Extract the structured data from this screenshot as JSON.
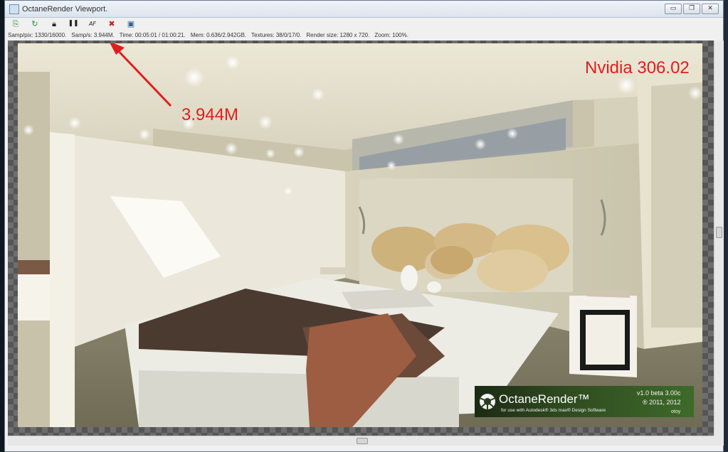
{
  "window": {
    "title": "OctaneRender Viewport.",
    "controls": {
      "minimize": "▭",
      "restore": "❐",
      "close": "✕"
    }
  },
  "toolbar": {
    "items": [
      {
        "name": "send-scene-icon",
        "glyph": "⎘",
        "color": "green"
      },
      {
        "name": "restart-icon",
        "glyph": "↻",
        "color": "green"
      },
      {
        "name": "lock-icon",
        "glyph": "🔒︎",
        "color": ""
      },
      {
        "name": "pause-icon",
        "glyph": "❚❚",
        "color": ""
      },
      {
        "name": "af-focus-icon",
        "glyph": "AF",
        "color": ""
      },
      {
        "name": "stop-icon",
        "glyph": "✖",
        "color": "red"
      },
      {
        "name": "settings-screen-icon",
        "glyph": "▣",
        "color": "blue"
      }
    ]
  },
  "status": {
    "samples_per_pixel": "Samp/pix: 1330/16000.",
    "samples_per_second": "Samp/s: 3.944M.",
    "time": "Time: 00:05:01 / 01:00:21.",
    "mem": "Mem: 0.636/2.942GB.",
    "textures": "Textures: 38/0/17/0.",
    "render_size": "Render size: 1280 x 720.",
    "zoom": "Zoom: 100%."
  },
  "annotations": {
    "speed_callout": "3.944M",
    "gpu_driver": "Nvidia 306.02"
  },
  "logo": {
    "name": "OctaneRender™",
    "tagline": "for use with Autodesk® 3ds max® Design Software",
    "version": "v1.0 beta 3.00c",
    "copyright": "® 2011, 2012",
    "brand": "otoy"
  },
  "colors": {
    "annotation": "#e01e1e",
    "viewport_checker": "#6e6e6e"
  }
}
